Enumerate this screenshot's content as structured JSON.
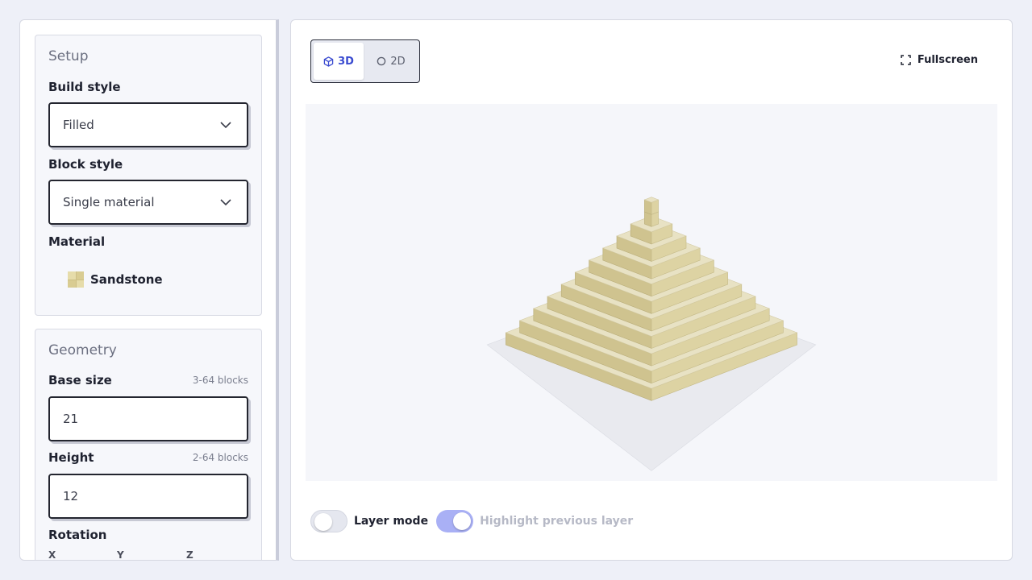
{
  "setup": {
    "title": "Setup",
    "build_style": {
      "label": "Build style",
      "value": "Filled"
    },
    "block_style": {
      "label": "Block style",
      "value": "Single material"
    },
    "material": {
      "label": "Material",
      "value": "Sandstone"
    }
  },
  "geometry": {
    "title": "Geometry",
    "base_size": {
      "label": "Base size",
      "hint": "3-64 blocks",
      "value": "21"
    },
    "height": {
      "label": "Height",
      "hint": "2-64 blocks",
      "value": "12"
    },
    "rotation": {
      "label": "Rotation",
      "axes": [
        "X",
        "Y",
        "Z"
      ]
    }
  },
  "view": {
    "mode_3d": "3D",
    "mode_2d": "2D",
    "active_mode": "3D",
    "fullscreen": "Fullscreen"
  },
  "layers": {
    "layer_mode": {
      "label": "Layer mode",
      "enabled": false
    },
    "highlight_previous": {
      "label": "Highlight previous layer",
      "enabled": true
    }
  },
  "colors": {
    "accent": "#3a4bd0",
    "toggle_on": "#a9b0f5",
    "sandstone_top": "#e8e2c4",
    "sandstone_left": "#cfc38f",
    "sandstone_right": "#ddd3a3"
  }
}
